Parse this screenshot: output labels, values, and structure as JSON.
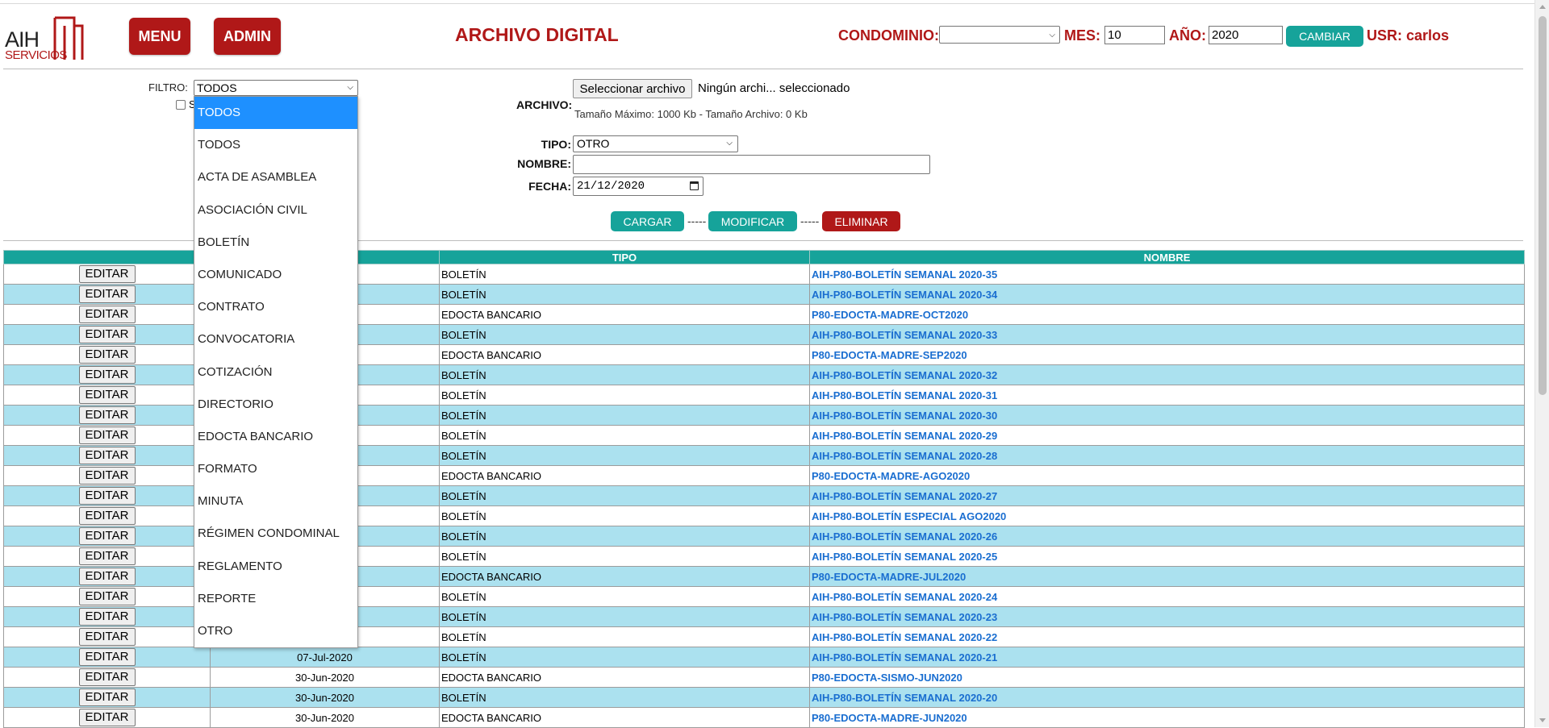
{
  "header": {
    "logo_text": "AIH",
    "logo_sub": "SERVICIOS",
    "menu_label": "MENU",
    "admin_label": "ADMIN",
    "title": "ARCHIVO DIGITAL",
    "condominio_label": "CONDOMINIO:",
    "condominio_value": "",
    "mes_label": "MES:",
    "mes_value": "10",
    "anio_label": "AÑO:",
    "anio_value": "2020",
    "cambiar_label": "CAMBIAR",
    "usr_label": "USR: carlos"
  },
  "filter": {
    "label": "FILTRO:",
    "selected": "TODOS",
    "checkbox_label": "S",
    "options": [
      "TODOS",
      "TODOS",
      "ACTA DE ASAMBLEA",
      "ASOCIACIÓN CIVIL",
      "BOLETÍN",
      "COMUNICADO",
      "CONTRATO",
      "CONVOCATORIA",
      "COTIZACIÓN",
      "DIRECTORIO",
      "EDOCTA BANCARIO",
      "FORMATO",
      "MINUTA",
      "RÉGIMEN CONDOMINAL",
      "REGLAMENTO",
      "REPORTE",
      "OTRO"
    ]
  },
  "form": {
    "archivo_label": "ARCHIVO:",
    "file_button": "Seleccionar archivo",
    "file_status": "Ningún archi... seleccionado",
    "file_info": "Tamaño Máximo: 1000 Kb - Tamaño Archivo: 0 Kb",
    "tipo_label": "TIPO:",
    "tipo_value": "OTRO",
    "nombre_label": "NOMBRE:",
    "nombre_value": "",
    "fecha_label": "FECHA:",
    "fecha_value": "21/12/2020",
    "cargar_label": "CARGAR",
    "modificar_label": "MODIFICAR",
    "eliminar_label": "ELIMINAR",
    "separator": "-----"
  },
  "table": {
    "headers": [
      "",
      "",
      "TIPO",
      "NOMBRE"
    ],
    "edit_label": "EDITAR",
    "rows": [
      {
        "date": "",
        "tipo": "BOLETÍN",
        "nombre": "AIH-P80-BOLETÍN SEMANAL 2020-35"
      },
      {
        "date": "",
        "tipo": "BOLETÍN",
        "nombre": "AIH-P80-BOLETÍN SEMANAL 2020-34"
      },
      {
        "date": "",
        "tipo": "EDOCTA BANCARIO",
        "nombre": "P80-EDOCTA-MADRE-OCT2020"
      },
      {
        "date": "",
        "tipo": "BOLETÍN",
        "nombre": "AIH-P80-BOLETÍN SEMANAL 2020-33"
      },
      {
        "date": "",
        "tipo": "EDOCTA BANCARIO",
        "nombre": "P80-EDOCTA-MADRE-SEP2020"
      },
      {
        "date": "",
        "tipo": "BOLETÍN",
        "nombre": "AIH-P80-BOLETÍN SEMANAL 2020-32"
      },
      {
        "date": "",
        "tipo": "BOLETÍN",
        "nombre": "AIH-P80-BOLETÍN SEMANAL 2020-31"
      },
      {
        "date": "",
        "tipo": "BOLETÍN",
        "nombre": "AIH-P80-BOLETÍN SEMANAL 2020-30"
      },
      {
        "date": "",
        "tipo": "BOLETÍN",
        "nombre": "AIH-P80-BOLETÍN SEMANAL 2020-29"
      },
      {
        "date": "",
        "tipo": "BOLETÍN",
        "nombre": "AIH-P80-BOLETÍN SEMANAL 2020-28"
      },
      {
        "date": "",
        "tipo": "EDOCTA BANCARIO",
        "nombre": "P80-EDOCTA-MADRE-AGO2020"
      },
      {
        "date": "",
        "tipo": "BOLETÍN",
        "nombre": "AIH-P80-BOLETÍN SEMANAL 2020-27"
      },
      {
        "date": "",
        "tipo": "BOLETÍN",
        "nombre": "AIH-P80-BOLETÍN ESPECIAL AGO2020"
      },
      {
        "date": "",
        "tipo": "BOLETÍN",
        "nombre": "AIH-P80-BOLETÍN SEMANAL 2020-26"
      },
      {
        "date": "",
        "tipo": "BOLETÍN",
        "nombre": "AIH-P80-BOLETÍN SEMANAL 2020-25"
      },
      {
        "date": "",
        "tipo": "EDOCTA BANCARIO",
        "nombre": "P80-EDOCTA-MADRE-JUL2020"
      },
      {
        "date": "",
        "tipo": "BOLETÍN",
        "nombre": "AIH-P80-BOLETÍN SEMANAL 2020-24"
      },
      {
        "date": "",
        "tipo": "BOLETÍN",
        "nombre": "AIH-P80-BOLETÍN SEMANAL 2020-23"
      },
      {
        "date": "",
        "tipo": "BOLETÍN",
        "nombre": "AIH-P80-BOLETÍN SEMANAL 2020-22"
      },
      {
        "date": "07-Jul-2020",
        "tipo": "BOLETÍN",
        "nombre": "AIH-P80-BOLETÍN SEMANAL 2020-21"
      },
      {
        "date": "30-Jun-2020",
        "tipo": "EDOCTA BANCARIO",
        "nombre": "P80-EDOCTA-SISMO-JUN2020"
      },
      {
        "date": "30-Jun-2020",
        "tipo": "BOLETÍN",
        "nombre": "AIH-P80-BOLETÍN SEMANAL 2020-20"
      },
      {
        "date": "30-Jun-2020",
        "tipo": "EDOCTA BANCARIO",
        "nombre": "P80-EDOCTA-MADRE-JUN2020"
      }
    ]
  },
  "colors": {
    "brand_red": "#b01818",
    "teal": "#16a39a",
    "row_alt": "#abe1ef",
    "link_blue": "#1a6ed0",
    "dropdown_highlight": "#1e90ff"
  }
}
